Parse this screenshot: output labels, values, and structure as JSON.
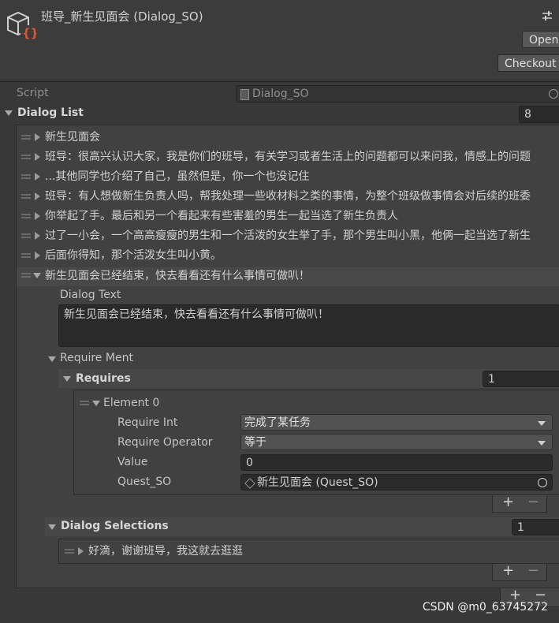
{
  "window": {
    "title": "班导_新生见面会 (Dialog_SO)",
    "open_label": "Open",
    "checkout_label": "Checkout"
  },
  "script": {
    "label": "Script",
    "value": "Dialog_SO"
  },
  "dialog_list": {
    "label": "Dialog List",
    "size": "8",
    "items": [
      "新生见面会",
      "班导：很高兴认识大家，我是你们的班导，有关学习或者生活上的问题都可以来问我，情感上的问题",
      "...其他同学也介绍了自己，虽然但是，你一个也没记住",
      "班导：有人想做新生负责人吗，帮我处理一些收材料之类的事情，为整个班级做事情会对后续的班委",
      "你举起了手。最后和另一个看起来有些害羞的男生一起当选了新生负责人",
      "过了一小会，一个高高瘦瘦的男生和一个活泼的女生举了手，那个男生叫小黑，他俩一起当选了新生",
      "后面你得知，那个活泼女生叫小黄。",
      "新生见面会已经结束，快去看看还有什么事情可做叭！"
    ]
  },
  "expanded": {
    "dialog_text_label": "Dialog Text",
    "dialog_text_value": "新生见面会已经结束，快去看看还有什么事情可做叭！",
    "require_ment_label": "Require Ment",
    "requires_label": "Requires",
    "requires_size": "1",
    "element_label": "Element 0",
    "require_int_label": "Require Int",
    "require_int_value": "完成了某任务",
    "require_operator_label": "Require Operator",
    "require_operator_value": "等于",
    "value_label": "Value",
    "value_value": "0",
    "quest_so_label": "Quest_SO",
    "quest_so_value": "新生见面会 (Quest_SO)",
    "dialog_selections_label": "Dialog Selections",
    "dialog_selections_size": "1",
    "selection_item": "好滴，谢谢班导，我这就去逛逛"
  },
  "controls": {
    "plus": "+",
    "minus": "−"
  },
  "watermark": "CSDN @m0_63745272",
  "icons": [
    "scriptable-object-icon",
    "settings-sliders-icon",
    "script-file-icon",
    "object-picker-icon",
    "quest-so-icon"
  ]
}
